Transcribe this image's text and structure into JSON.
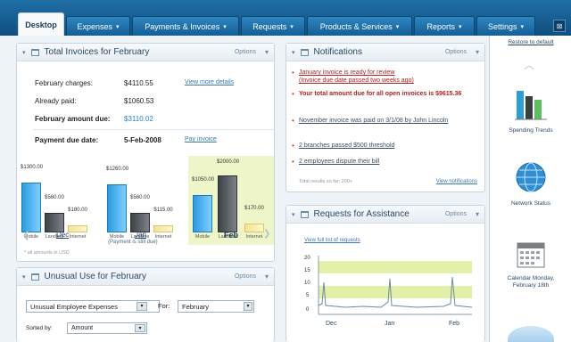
{
  "nav": {
    "tabs": [
      {
        "label": "Desktop",
        "arrow": ""
      },
      {
        "label": "Expenses",
        "arrow": "▾"
      },
      {
        "label": "Payments & Invoices",
        "arrow": "▾"
      },
      {
        "label": "Requests",
        "arrow": "▾"
      },
      {
        "label": "Products & Services",
        "arrow": "▾"
      },
      {
        "label": "Reports",
        "arrow": "▾"
      },
      {
        "label": "Settings",
        "arrow": "▾"
      }
    ],
    "close_label": "⊠"
  },
  "invoices": {
    "title": "Total Invoices for February",
    "options": "Options",
    "rows": [
      {
        "label": "February charges:",
        "value": "$4110.55",
        "link": "View more details"
      },
      {
        "label": "Already paid:",
        "value": "$1060.53",
        "link": ""
      },
      {
        "label": "February amount due:",
        "value": "$3110.02",
        "link": ""
      },
      {
        "label": "Payment due date:",
        "value": "5-Feb-2008",
        "link": "Pay invoice"
      }
    ],
    "months": [
      {
        "name": "Dec",
        "bars": [
          {
            "v": "$1300.00",
            "l": "Mobile"
          },
          {
            "v": "$560.00",
            "l": "Landline"
          },
          {
            "v": "$180.00",
            "l": "Internet"
          }
        ]
      },
      {
        "name": "Jan",
        "bars": [
          {
            "v": "$1260.00",
            "l": "Mobile"
          },
          {
            "v": "$560.00",
            "l": "Landline"
          },
          {
            "v": "$115.00",
            "l": "Internet"
          }
        ],
        "note": "(Payment is still due)"
      },
      {
        "name": "Feb",
        "bars": [
          {
            "v": "$1050.00",
            "l": "Mobile"
          },
          {
            "v": "$2000.00",
            "l": "Landline"
          },
          {
            "v": "$170.00",
            "l": "Internet"
          }
        ]
      }
    ],
    "footnote": "* all amounts in USD"
  },
  "unusual": {
    "title": "Unusual Use for February",
    "options": "Options",
    "select1": "Unusual Employee Expenses",
    "for_label": "For:",
    "select2": "February",
    "sort_label": "Sorted by:",
    "select3": "Amount"
  },
  "notifications": {
    "title": "Notifications",
    "options": "Options",
    "items": [
      {
        "text": "January invoice is ready for review",
        "sub": "(Invoice due date passed two weeks ago)",
        "style": "redu"
      },
      {
        "text": "Your total amount due for all open invoices is $9615.36",
        "sub": "",
        "style": "red"
      },
      {
        "text": "November invoice was paid on 3/1/08 by John Lincoln",
        "sub": "",
        "style": "norm"
      },
      {
        "text": "2 branches passed $500 threshold",
        "sub": "",
        "style": "norm"
      },
      {
        "text": "2 employees dispute their bill",
        "sub": "",
        "style": "norm"
      }
    ],
    "footer_left": "Total results so far: 200+",
    "footer_right": "View notifications"
  },
  "assistance": {
    "title": "Requests for Assistance",
    "options": "Options",
    "link": "View full list of requests",
    "y_ticks": [
      "20",
      "15",
      "10",
      "5",
      "0"
    ],
    "x_ticks": [
      "Dec",
      "Jan",
      "Feb"
    ]
  },
  "rail": {
    "restore": "Restore to default",
    "items": [
      {
        "label": "Spending Trends"
      },
      {
        "label": "Network Status"
      },
      {
        "label": "Calendar Monday, February 18th"
      }
    ]
  }
}
